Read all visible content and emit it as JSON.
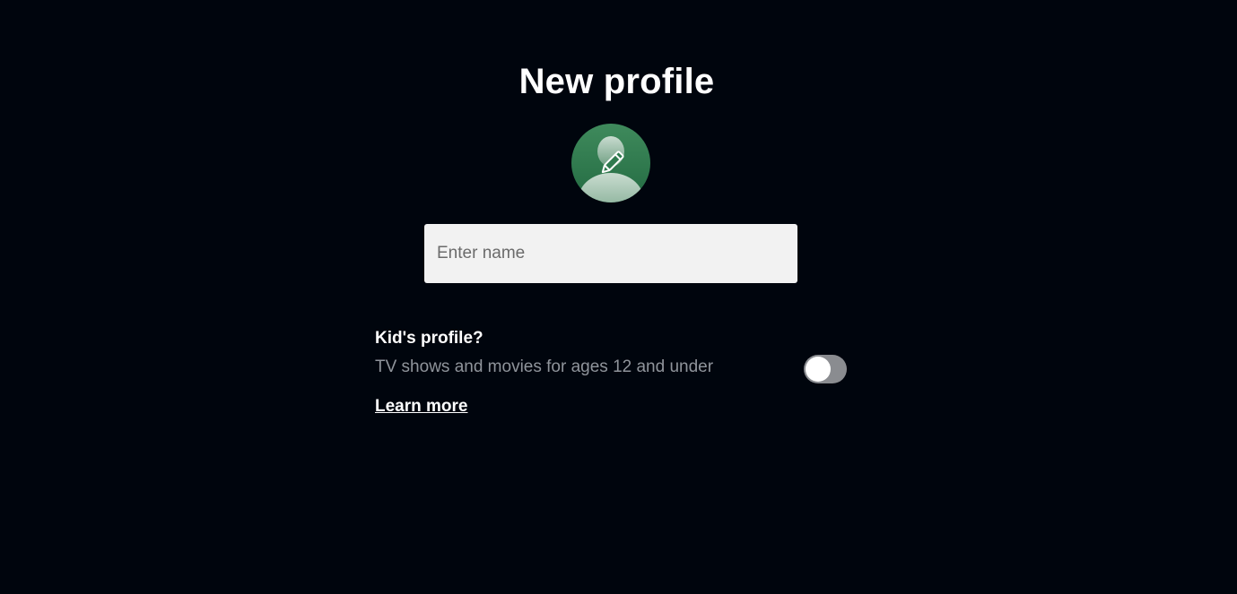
{
  "page": {
    "title": "New profile"
  },
  "avatar": {
    "icon": "person-with-pencil-icon",
    "color": "#2e7d4f"
  },
  "name_field": {
    "value": "",
    "placeholder": "Enter name"
  },
  "kids_profile": {
    "title": "Kid's profile?",
    "description": "TV shows and movies for ages 12 and under",
    "enabled": false,
    "learn_more_label": "Learn more"
  },
  "colors": {
    "background": "#00050d",
    "input_background": "#f2f2f2",
    "toggle_off": "#8a8c90"
  }
}
